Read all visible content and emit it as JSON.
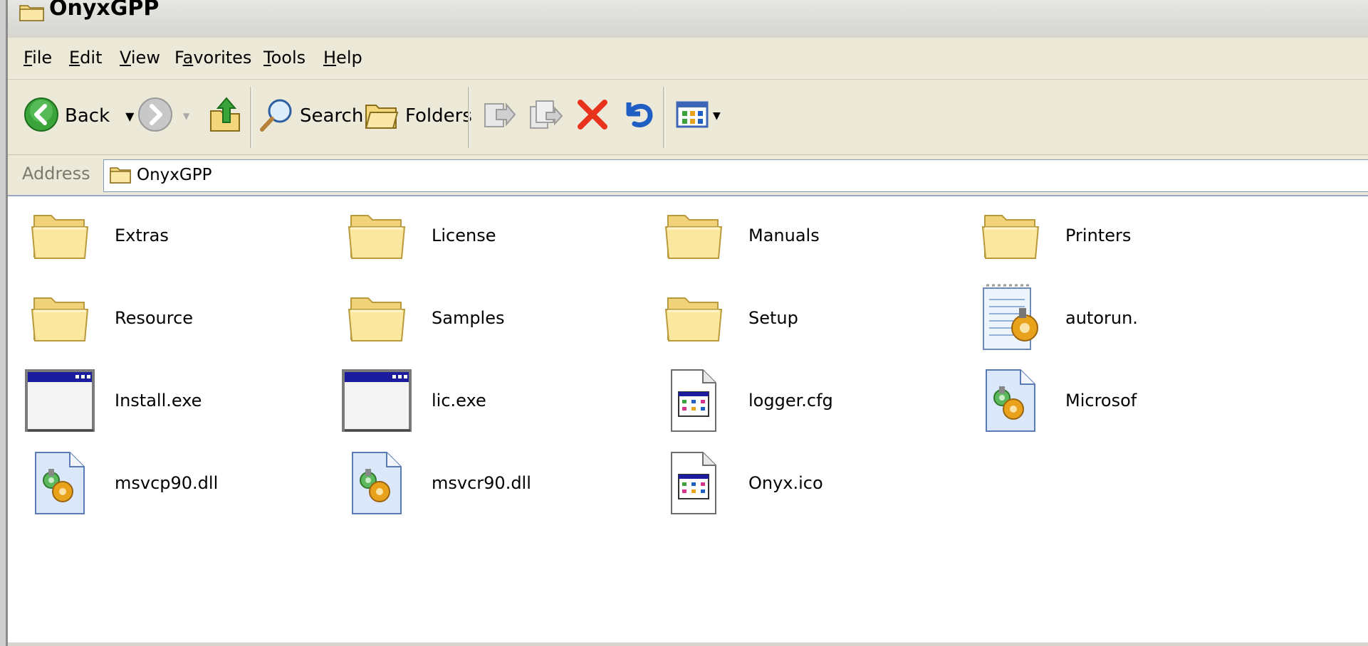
{
  "window": {
    "title": "OnyxGPP"
  },
  "menu": [
    "File",
    "Edit",
    "View",
    "Favorites",
    "Tools",
    "Help"
  ],
  "menu_underline": [
    "F",
    "E",
    "V",
    "a",
    "T",
    "H"
  ],
  "toolbar": {
    "back_label": "Back",
    "search_label": "Search",
    "folders_label": "Folders"
  },
  "address": {
    "label": "Address",
    "value": "OnyxGPP"
  },
  "files": [
    {
      "name": "Extras",
      "icon": "folder-icon"
    },
    {
      "name": "License",
      "icon": "folder-icon"
    },
    {
      "name": "Manuals",
      "icon": "folder-icon"
    },
    {
      "name": "Printers",
      "icon": "folder-icon"
    },
    {
      "name": "Resource",
      "icon": "folder-icon"
    },
    {
      "name": "Samples",
      "icon": "folder-icon"
    },
    {
      "name": "Setup",
      "icon": "folder-icon"
    },
    {
      "name": "autorun.",
      "icon": "autorun-inf-icon"
    },
    {
      "name": "Install.exe",
      "icon": "exe-window-icon"
    },
    {
      "name": "lic.exe",
      "icon": "exe-window-icon"
    },
    {
      "name": "logger.cfg",
      "icon": "generic-file-icon"
    },
    {
      "name": "Microsof",
      "icon": "dll-gear-icon"
    },
    {
      "name": "msvcp90.dll",
      "icon": "dll-gear-icon"
    },
    {
      "name": "msvcr90.dll",
      "icon": "dll-gear-icon"
    },
    {
      "name": "Onyx.ico",
      "icon": "generic-file-icon"
    }
  ],
  "colors": {
    "xp_blue": "#0a246a",
    "folder_yellow": "#f6e28d",
    "accent_green": "#3ba33b",
    "delete_red": "#e8341c"
  }
}
